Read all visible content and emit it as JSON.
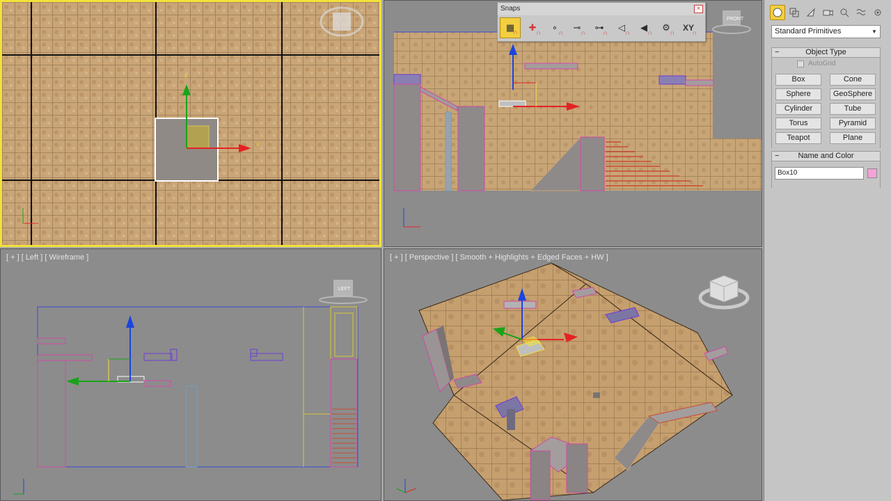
{
  "viewports": {
    "top": {
      "label": ""
    },
    "front": {
      "label": "",
      "viewcube": "FRONT"
    },
    "left": {
      "label": "[ + ] [ Left ] [ Wireframe ]",
      "viewcube": "LEFT"
    },
    "perspective": {
      "label": "[ + ] [ Perspective ] [ Smooth + Highlights + Edged Faces + HW ]"
    }
  },
  "snaps_toolbar": {
    "title": "Snaps",
    "buttons": [
      {
        "name": "grid-points-snap",
        "icon": "grid-icon",
        "active": true
      },
      {
        "name": "pivot-snap",
        "icon": "pivot-icon",
        "active": false
      },
      {
        "name": "vertex-snap",
        "icon": "vertex-icon",
        "active": false
      },
      {
        "name": "endpoint-snap",
        "icon": "endpoint-icon",
        "active": false
      },
      {
        "name": "midpoint-snap",
        "icon": "midpoint-icon",
        "active": false
      },
      {
        "name": "edge-snap",
        "icon": "edge-icon",
        "active": false
      },
      {
        "name": "face-snap",
        "icon": "face-icon",
        "active": false
      },
      {
        "name": "options-snap",
        "icon": "gear-icon",
        "active": false
      },
      {
        "name": "axis-constraint-snap",
        "icon": "xy-icon",
        "active": false,
        "text": "XY"
      }
    ]
  },
  "command_panel": {
    "category_dropdown": "Standard Primitives",
    "object_type": {
      "title": "Object Type",
      "autogrid_label": "AutoGrid",
      "buttons": [
        "Box",
        "Cone",
        "Sphere",
        "GeoSphere",
        "Cylinder",
        "Tube",
        "Torus",
        "Pyramid",
        "Teapot",
        "Plane"
      ]
    },
    "name_and_color": {
      "title": "Name and Color",
      "name_value": "Box10",
      "color": "#f4a3d9"
    }
  },
  "colors": {
    "active_viewport_border": "#f2e23a",
    "selection_pink": "#d04aa6",
    "gizmo_x": "#e52222",
    "gizmo_y": "#1aa31a",
    "gizmo_z": "#1b44e0"
  }
}
